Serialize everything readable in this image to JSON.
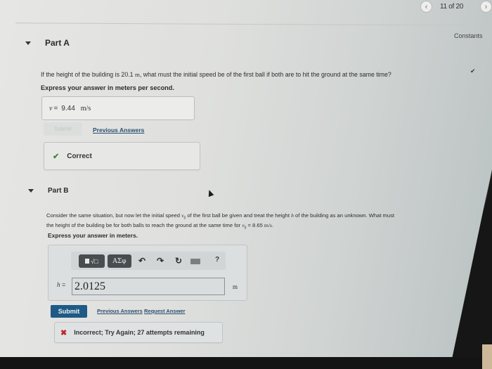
{
  "navigation": {
    "prev_icon": "chevron-left-icon",
    "page_indicator": "11 of 20",
    "next_icon": "chevron-right-icon"
  },
  "constants_link": "Constants",
  "part_a": {
    "title": "Part A",
    "status_icon": "checkmark-icon",
    "question_prefix": "If the height of the building is 20.1 ",
    "question_unit": "m",
    "question_suffix": ", what must the initial speed be of the first ball if both are to hit the ground at the same time?",
    "instruction": "Express your answer in meters per second.",
    "answer": {
      "variable": "v",
      "equals": "=",
      "value": "9.44",
      "unit": "m/s"
    },
    "submit_label": "Submit",
    "previous_answers_label": "Previous Answers",
    "feedback": {
      "icon": "checkmark-icon",
      "text": "Correct",
      "color": "#3c8a2e"
    }
  },
  "part_b": {
    "title": "Part B",
    "question_line1_a": "Consider the same situation, but now let the initial speed ",
    "question_line1_var": "v",
    "question_line1_sub": "0",
    "question_line1_b": " of the first ball be given and treat the height ",
    "question_line1_var2": "h",
    "question_line1_c": " of the building as an unknown. What must",
    "question_line2_a": "the height of the building be for both balls to reach the ground at the same time for ",
    "question_line2_var": "v",
    "question_line2_sub": "0",
    "question_line2_b": " = 8.65 ",
    "question_line2_unit": "m/s",
    "question_line2_end": ".",
    "instruction": "Express your answer in meters.",
    "toolbar": {
      "template_label": "√□",
      "greek_label": "ΑΣφ",
      "undo_icon": "undo-icon",
      "redo_icon": "redo-icon",
      "reset_icon": "reset-icon",
      "keyboard_icon": "keyboard-icon",
      "help_label": "?"
    },
    "answer": {
      "variable": "h",
      "equals": "=",
      "value": "2.0125",
      "unit": "m"
    },
    "submit_label": "Submit",
    "previous_answers_label": "Previous Answers",
    "request_answer_label": "Request Answer",
    "feedback": {
      "icon": "x-icon",
      "text": "Incorrect; Try Again; 27 attempts remaining",
      "color": "#c0262c"
    }
  },
  "colors": {
    "submit_active": "#1e5a85",
    "link": "#2a4f6f",
    "toolbar_button": "#4a4d50"
  }
}
